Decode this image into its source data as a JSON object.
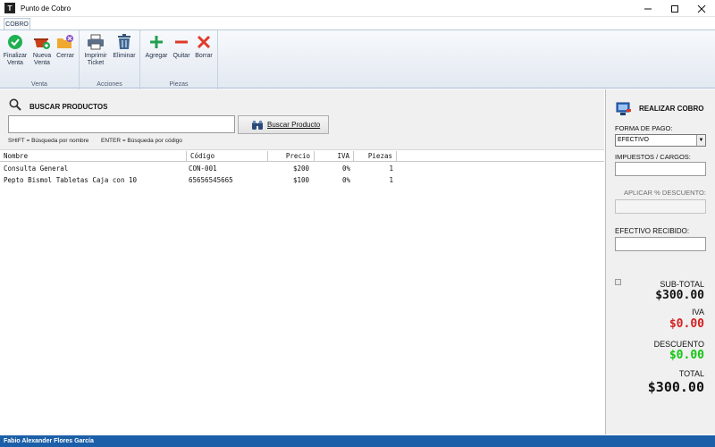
{
  "window": {
    "title": "Punto de Cobro",
    "icon_letter": "T"
  },
  "ribbon": {
    "tab": "COBRO",
    "groups": [
      {
        "label": "Venta",
        "buttons": [
          {
            "label1": "Finalizar",
            "label2": "Venta",
            "icon": "check-circle-icon"
          },
          {
            "label1": "Nueva",
            "label2": "Venta",
            "icon": "basket-add-icon"
          },
          {
            "label1": "Cerrar",
            "label2": "",
            "icon": "folder-close-icon"
          }
        ]
      },
      {
        "label": "Acciones",
        "buttons": [
          {
            "label1": "Imprimir",
            "label2": "Ticket",
            "icon": "printer-icon"
          },
          {
            "label1": "Eliminar",
            "label2": "",
            "icon": "trash-icon"
          }
        ]
      },
      {
        "label": "Piezas",
        "buttons": [
          {
            "label1": "Agregar",
            "label2": "",
            "icon": "plus-icon"
          },
          {
            "label1": "Quitar",
            "label2": "",
            "icon": "minus-icon"
          },
          {
            "label1": "Borrar",
            "label2": "",
            "icon": "x-icon"
          }
        ]
      }
    ]
  },
  "search": {
    "title": "BUSCAR PRODUCTOS",
    "value": "",
    "button_label": "Buscar Producto",
    "hint_shift": "SHIFT = Búsqueda por nombre",
    "hint_enter": "ENTER = Búsqueda por código"
  },
  "table": {
    "headers": [
      "Nombre",
      "Código",
      "Precio",
      "IVA",
      "Piezas"
    ],
    "rows": [
      {
        "nombre": "Consulta General",
        "codigo": "CON-001",
        "precio": "$200",
        "iva": "0%",
        "piezas": "1"
      },
      {
        "nombre": "Pepto Bismol Tabletas Caja con 10",
        "codigo": "65656545665",
        "precio": "$100",
        "iva": "0%",
        "piezas": "1"
      }
    ]
  },
  "cobro": {
    "title": "REALIZAR COBRO",
    "forma_pago_label": "FORMA DE PAGO:",
    "forma_pago_value": "EFECTIVO",
    "impuestos_label": "IMPUESTOS / CARGOS:",
    "descuento_label": "APLICAR % DESCUENTO:",
    "efectivo_label": "EFECTIVO RECIBIDO:",
    "subtotal_label": "SUB-TOTAL",
    "subtotal_value": "$300.00",
    "iva_label": "IVA",
    "iva_value": "$0.00",
    "descuento_total_label": "DESCUENTO",
    "descuento_value": "$0.00",
    "total_label": "TOTAL",
    "total_value": "$300.00"
  },
  "colors": {
    "iva": "#d42020",
    "descuento": "#12c412",
    "status": "#1b5fa8"
  },
  "status": {
    "user": "Fabio Alexander Flores García"
  }
}
